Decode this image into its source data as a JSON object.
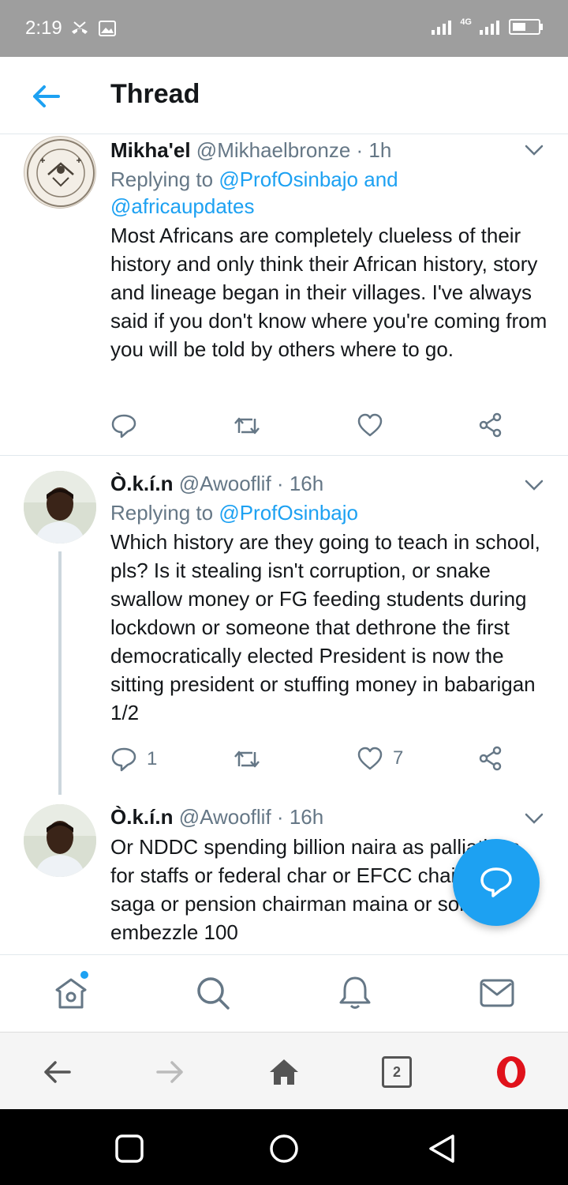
{
  "status_bar": {
    "time": "2:19",
    "network": "4G"
  },
  "header": {
    "title": "Thread"
  },
  "tweets": [
    {
      "name": "Mikha'el",
      "handle": "@Mikhaelbronze",
      "sep": "·",
      "time": "1h",
      "reply_prefix": "Replying to",
      "reply_mentions": "@ProfOsinbajo and @africaupdates",
      "text": "Most Africans are completely clueless of their history and only think their African history, story and lineage began in their villages. I've always said if you don't know where you're coming from you will be told by others where to go.",
      "reply_count": "",
      "like_count": ""
    },
    {
      "name": "Ò.k.í.n",
      "handle": "@Awooflif",
      "sep": "·",
      "time": "16h",
      "reply_prefix": "Replying to",
      "reply_mentions": "@ProfOsinbajo",
      "text": "Which history are they going to teach in school, pls? Is it stealing isn't corruption, or snake swallow money or FG feeding students during lockdown or someone that dethrone the first democratically elected President is now the sitting president or stuffing money in babarigan 1/2",
      "reply_count": "1",
      "like_count": "7"
    },
    {
      "name": "Ò.k.í.n",
      "handle": "@Awooflif",
      "sep": "·",
      "time": "16h",
      "text": "Or NDDC spending billion naira as palliatives for staffs or federal char or EFCC chairman saga or pension chairman maina or someone embezzle 100"
    }
  ],
  "browser": {
    "tab_count": "2"
  },
  "colors": {
    "accent": "#1da1f2",
    "muted": "#657786",
    "text": "#14171a",
    "opera_red": "#e0121b"
  },
  "icons": {
    "tab_bar": [
      "home-icon",
      "search-icon",
      "bell-icon",
      "mail-icon"
    ],
    "actions": [
      "reply-icon",
      "retweet-icon",
      "like-icon",
      "share-icon"
    ]
  }
}
